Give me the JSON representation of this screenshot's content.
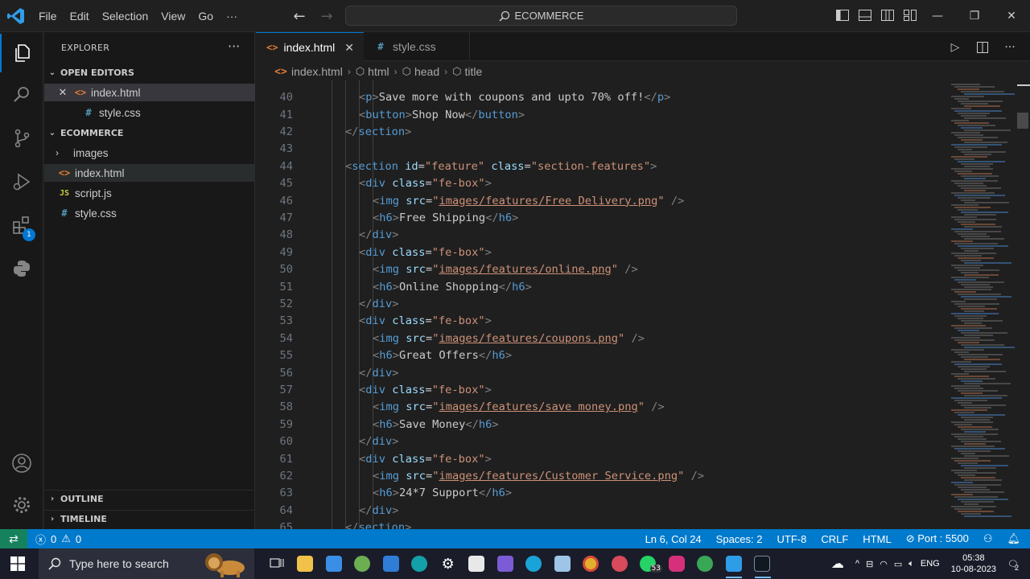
{
  "menu": {
    "file": "File",
    "edit": "Edit",
    "selection": "Selection",
    "view": "View",
    "go": "Go",
    "more": "···"
  },
  "command_center": {
    "label": "ECOMMERCE"
  },
  "explorer": {
    "title": "EXPLORER",
    "more": "···",
    "open_editors": {
      "label": "OPEN EDITORS",
      "items": [
        {
          "name": "index.html",
          "icon": "html"
        },
        {
          "name": "style.css",
          "icon": "css"
        }
      ]
    },
    "workspace": {
      "label": "ECOMMERCE",
      "items": [
        {
          "name": "images",
          "type": "folder"
        },
        {
          "name": "index.html",
          "icon": "html"
        },
        {
          "name": "script.js",
          "icon": "js"
        },
        {
          "name": "style.css",
          "icon": "css"
        }
      ]
    },
    "outline": "OUTLINE",
    "timeline": "TIMELINE"
  },
  "tabs": [
    {
      "label": "index.html",
      "active": true
    },
    {
      "label": "style.css",
      "active": false
    }
  ],
  "breadcrumb": {
    "file": "index.html",
    "path": [
      "html",
      "head",
      "title"
    ]
  },
  "editor": {
    "lines": [
      {
        "n": "40",
        "indent": 2,
        "parts": [
          [
            "t",
            "<"
          ],
          [
            "n",
            "p"
          ],
          [
            "t",
            ">"
          ],
          [
            "tx",
            "Save more with coupons and upto 70% off!"
          ],
          [
            "t",
            "</"
          ],
          [
            "n",
            "p"
          ],
          [
            "t",
            ">"
          ]
        ]
      },
      {
        "n": "41",
        "indent": 2,
        "parts": [
          [
            "t",
            "<"
          ],
          [
            "n",
            "button"
          ],
          [
            "t",
            ">"
          ],
          [
            "tx",
            "Shop Now"
          ],
          [
            "t",
            "</"
          ],
          [
            "n",
            "button"
          ],
          [
            "t",
            ">"
          ]
        ]
      },
      {
        "n": "42",
        "indent": 1,
        "parts": [
          [
            "t",
            "</"
          ],
          [
            "n",
            "section"
          ],
          [
            "t",
            ">"
          ]
        ]
      },
      {
        "n": "43",
        "indent": 0,
        "parts": []
      },
      {
        "n": "44",
        "indent": 1,
        "parts": [
          [
            "t",
            "<"
          ],
          [
            "n",
            "section"
          ],
          [
            "tx",
            " "
          ],
          [
            "a",
            "id"
          ],
          [
            "tx",
            "="
          ],
          [
            "s",
            "\"feature\""
          ],
          [
            "tx",
            " "
          ],
          [
            "a",
            "class"
          ],
          [
            "tx",
            "="
          ],
          [
            "s",
            "\"section-features\""
          ],
          [
            "t",
            ">"
          ]
        ]
      },
      {
        "n": "45",
        "indent": 2,
        "parts": [
          [
            "t",
            "<"
          ],
          [
            "n",
            "div"
          ],
          [
            "tx",
            " "
          ],
          [
            "a",
            "class"
          ],
          [
            "tx",
            "="
          ],
          [
            "s",
            "\"fe-box\""
          ],
          [
            "t",
            ">"
          ]
        ]
      },
      {
        "n": "46",
        "indent": 3,
        "parts": [
          [
            "t",
            "<"
          ],
          [
            "n",
            "img"
          ],
          [
            "tx",
            " "
          ],
          [
            "a",
            "src"
          ],
          [
            "tx",
            "="
          ],
          [
            "s",
            "\""
          ],
          [
            "su",
            "images/features/Free Delivery.png"
          ],
          [
            "s",
            "\""
          ],
          [
            "tx",
            " "
          ],
          [
            "t",
            "/>"
          ]
        ]
      },
      {
        "n": "47",
        "indent": 3,
        "parts": [
          [
            "t",
            "<"
          ],
          [
            "n",
            "h6"
          ],
          [
            "t",
            ">"
          ],
          [
            "tx",
            "Free Shipping"
          ],
          [
            "t",
            "</"
          ],
          [
            "n",
            "h6"
          ],
          [
            "t",
            ">"
          ]
        ]
      },
      {
        "n": "48",
        "indent": 2,
        "parts": [
          [
            "t",
            "</"
          ],
          [
            "n",
            "div"
          ],
          [
            "t",
            ">"
          ]
        ]
      },
      {
        "n": "49",
        "indent": 2,
        "parts": [
          [
            "t",
            "<"
          ],
          [
            "n",
            "div"
          ],
          [
            "tx",
            " "
          ],
          [
            "a",
            "class"
          ],
          [
            "tx",
            "="
          ],
          [
            "s",
            "\"fe-box\""
          ],
          [
            "t",
            ">"
          ]
        ]
      },
      {
        "n": "50",
        "indent": 3,
        "parts": [
          [
            "t",
            "<"
          ],
          [
            "n",
            "img"
          ],
          [
            "tx",
            " "
          ],
          [
            "a",
            "src"
          ],
          [
            "tx",
            "="
          ],
          [
            "s",
            "\""
          ],
          [
            "su",
            "images/features/online.png"
          ],
          [
            "s",
            "\""
          ],
          [
            "tx",
            " "
          ],
          [
            "t",
            "/>"
          ]
        ]
      },
      {
        "n": "51",
        "indent": 3,
        "parts": [
          [
            "t",
            "<"
          ],
          [
            "n",
            "h6"
          ],
          [
            "t",
            ">"
          ],
          [
            "tx",
            "Online Shopping"
          ],
          [
            "t",
            "</"
          ],
          [
            "n",
            "h6"
          ],
          [
            "t",
            ">"
          ]
        ]
      },
      {
        "n": "52",
        "indent": 2,
        "parts": [
          [
            "t",
            "</"
          ],
          [
            "n",
            "div"
          ],
          [
            "t",
            ">"
          ]
        ]
      },
      {
        "n": "53",
        "indent": 2,
        "parts": [
          [
            "t",
            "<"
          ],
          [
            "n",
            "div"
          ],
          [
            "tx",
            " "
          ],
          [
            "a",
            "class"
          ],
          [
            "tx",
            "="
          ],
          [
            "s",
            "\"fe-box\""
          ],
          [
            "t",
            ">"
          ]
        ]
      },
      {
        "n": "54",
        "indent": 3,
        "parts": [
          [
            "t",
            "<"
          ],
          [
            "n",
            "img"
          ],
          [
            "tx",
            " "
          ],
          [
            "a",
            "src"
          ],
          [
            "tx",
            "="
          ],
          [
            "s",
            "\""
          ],
          [
            "su",
            "images/features/coupons.png"
          ],
          [
            "s",
            "\""
          ],
          [
            "tx",
            " "
          ],
          [
            "t",
            "/>"
          ]
        ]
      },
      {
        "n": "55",
        "indent": 3,
        "parts": [
          [
            "t",
            "<"
          ],
          [
            "n",
            "h6"
          ],
          [
            "t",
            ">"
          ],
          [
            "tx",
            "Great Offers"
          ],
          [
            "t",
            "</"
          ],
          [
            "n",
            "h6"
          ],
          [
            "t",
            ">"
          ]
        ]
      },
      {
        "n": "56",
        "indent": 2,
        "parts": [
          [
            "t",
            "</"
          ],
          [
            "n",
            "div"
          ],
          [
            "t",
            ">"
          ]
        ]
      },
      {
        "n": "57",
        "indent": 2,
        "parts": [
          [
            "t",
            "<"
          ],
          [
            "n",
            "div"
          ],
          [
            "tx",
            " "
          ],
          [
            "a",
            "class"
          ],
          [
            "tx",
            "="
          ],
          [
            "s",
            "\"fe-box\""
          ],
          [
            "t",
            ">"
          ]
        ]
      },
      {
        "n": "58",
        "indent": 3,
        "parts": [
          [
            "t",
            "<"
          ],
          [
            "n",
            "img"
          ],
          [
            "tx",
            " "
          ],
          [
            "a",
            "src"
          ],
          [
            "tx",
            "="
          ],
          [
            "s",
            "\""
          ],
          [
            "su",
            "images/features/save money.png"
          ],
          [
            "s",
            "\""
          ],
          [
            "tx",
            " "
          ],
          [
            "t",
            "/>"
          ]
        ]
      },
      {
        "n": "59",
        "indent": 3,
        "parts": [
          [
            "t",
            "<"
          ],
          [
            "n",
            "h6"
          ],
          [
            "t",
            ">"
          ],
          [
            "tx",
            "Save Money"
          ],
          [
            "t",
            "</"
          ],
          [
            "n",
            "h6"
          ],
          [
            "t",
            ">"
          ]
        ]
      },
      {
        "n": "60",
        "indent": 2,
        "parts": [
          [
            "t",
            "</"
          ],
          [
            "n",
            "div"
          ],
          [
            "t",
            ">"
          ]
        ]
      },
      {
        "n": "61",
        "indent": 2,
        "parts": [
          [
            "t",
            "<"
          ],
          [
            "n",
            "div"
          ],
          [
            "tx",
            " "
          ],
          [
            "a",
            "class"
          ],
          [
            "tx",
            "="
          ],
          [
            "s",
            "\"fe-box\""
          ],
          [
            "t",
            ">"
          ]
        ]
      },
      {
        "n": "62",
        "indent": 3,
        "parts": [
          [
            "t",
            "<"
          ],
          [
            "n",
            "img"
          ],
          [
            "tx",
            " "
          ],
          [
            "a",
            "src"
          ],
          [
            "tx",
            "="
          ],
          [
            "s",
            "\""
          ],
          [
            "su",
            "images/features/Customer Service.png"
          ],
          [
            "s",
            "\""
          ],
          [
            "tx",
            " "
          ],
          [
            "t",
            "/>"
          ]
        ]
      },
      {
        "n": "63",
        "indent": 3,
        "parts": [
          [
            "t",
            "<"
          ],
          [
            "n",
            "h6"
          ],
          [
            "t",
            ">"
          ],
          [
            "tx",
            "24*7 Support"
          ],
          [
            "t",
            "</"
          ],
          [
            "n",
            "h6"
          ],
          [
            "t",
            ">"
          ]
        ]
      },
      {
        "n": "64",
        "indent": 2,
        "parts": [
          [
            "t",
            "</"
          ],
          [
            "n",
            "div"
          ],
          [
            "t",
            ">"
          ]
        ]
      },
      {
        "n": "65",
        "indent": 1,
        "parts": [
          [
            "t",
            "</"
          ],
          [
            "n",
            "section"
          ],
          [
            "t",
            ">"
          ]
        ]
      }
    ]
  },
  "statusbar": {
    "errors": "0",
    "warnings": "0",
    "position": "Ln 6, Col 24",
    "spaces": "Spaces: 2",
    "encoding": "UTF-8",
    "eol": "CRLF",
    "language": "HTML",
    "port": "Port : 5500"
  },
  "taskbar": {
    "search_placeholder": "Type here to search",
    "whatsapp_badge": "53",
    "language": "ENG",
    "time": "05:38",
    "date": "10-08-2023",
    "notif_count": "2"
  },
  "activity": {
    "extensions_badge": "1"
  },
  "colors": {
    "accent": "#007acc",
    "status_remote": "#16825d",
    "tag": "#569cd6",
    "attr": "#9cdcfe",
    "string": "#ce9178"
  }
}
